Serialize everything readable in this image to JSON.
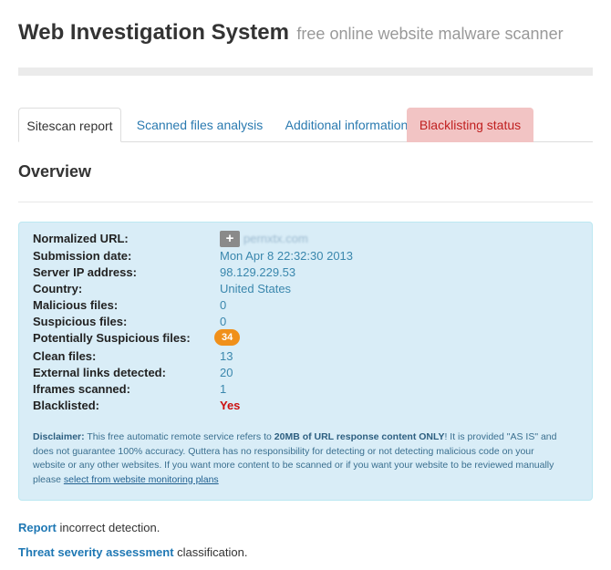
{
  "header": {
    "title": "Web Investigation System",
    "subtitle": "free online website malware scanner"
  },
  "tabs": [
    {
      "label": "Sitescan report",
      "active": true
    },
    {
      "label": "Scanned files analysis",
      "active": false
    },
    {
      "label": "Additional information",
      "active": false
    },
    {
      "label": "Blacklisting status",
      "active": false
    }
  ],
  "overview": {
    "title": "Overview",
    "rows": [
      {
        "label": "Normalized URL:",
        "value": "pernxtx.com"
      },
      {
        "label": "Submission date:",
        "value": "Mon Apr 8 22:32:30 2013"
      },
      {
        "label": "Server IP address:",
        "value": "98.129.229.53"
      },
      {
        "label": "Country:",
        "value": "United States"
      },
      {
        "label": "Malicious files:",
        "value": "0"
      },
      {
        "label": "Suspicious files:",
        "value": "0"
      },
      {
        "label": "Potentially Suspicious files:",
        "value": "34"
      },
      {
        "label": "Clean files:",
        "value": "13"
      },
      {
        "label": "External links detected:",
        "value": "20"
      },
      {
        "label": "Iframes scanned:",
        "value": "1"
      },
      {
        "label": "Blacklisted:",
        "value": "Yes"
      }
    ],
    "url_icon": "plus-icon",
    "disclaimer": {
      "lead": "Disclaimer:",
      "text1": " This free automatic remote service refers to ",
      "bold": "20MB of URL response content ONLY",
      "text2": "! It is provided \"AS IS\" and does not guarantee 100% accuracy. Quttera has no responsibility for detecting or not detecting malicious code on your website or any other websites. If you want more content to be scanned or if you want your website to be reviewed manually please ",
      "link": "select from website monitoring plans"
    }
  },
  "footer": {
    "report_link": "Report",
    "report_text": " incorrect detection.",
    "threat_link": "Threat severity assessment",
    "threat_text": " classification."
  },
  "colors": {
    "panel_bg": "#d9edf7",
    "link": "#2a7ab0",
    "danger": "#cc1111",
    "badge": "#f0901a",
    "blacklist_tab_bg": "#f2c4c4"
  }
}
